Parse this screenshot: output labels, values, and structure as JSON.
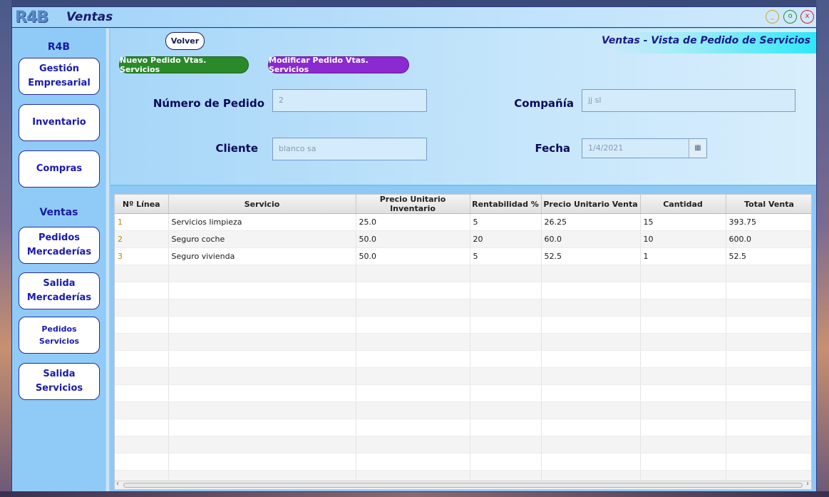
{
  "window": {
    "logo": "R4B",
    "title": "Ventas",
    "controls": {
      "minimize": "_",
      "maximize": "o",
      "close": "x"
    }
  },
  "sidebar": {
    "heading_top": "R4B",
    "heading_ventas": "Ventas",
    "items": [
      {
        "label": "Gestión\nEmpresarial"
      },
      {
        "label": "Inventario"
      },
      {
        "label": "Compras"
      },
      {
        "label": "Pedidos\nMercaderías"
      },
      {
        "label": "Salida\nMercaderías"
      },
      {
        "label": "Pedidos\nServicios"
      },
      {
        "label": "Salida\nServicios"
      }
    ]
  },
  "header": {
    "title": "Ventas - Vista de Pedido de Servicios",
    "volver_label": "Volver",
    "nuevo_label": "Nuevo Pedido Vtas. Servicios",
    "modificar_label": "Modificar Pedido Vtas. Servicios"
  },
  "form": {
    "numero_label": "Número de Pedido",
    "numero_value": "2",
    "compania_label": "Compañía",
    "compania_value": "jj sl",
    "cliente_label": "Cliente",
    "cliente_value": "blanco sa",
    "fecha_label": "Fecha",
    "fecha_value": "1/4/2021",
    "calendar_icon": "calendar-icon"
  },
  "table": {
    "columns": [
      "Nº Línea",
      "Servicio",
      "Precio Unitario Inventario",
      "Rentabilidad %",
      "Precio Unitario Venta",
      "Cantidad",
      "Total Venta"
    ],
    "rows": [
      [
        "1",
        "Servicios limpieza",
        "25.0",
        "5",
        "26.25",
        "15",
        "393.75"
      ],
      [
        "2",
        "Seguro coche",
        "50.0",
        "20",
        "60.0",
        "10",
        "600.0"
      ],
      [
        "3",
        "Seguro vivienda",
        "50.0",
        "5",
        "52.5",
        "1",
        "52.5"
      ]
    ],
    "empty_rows": 13
  },
  "colors": {
    "accent_green": "#2a8a2a",
    "accent_purple": "#8a2ad0",
    "sidebar_bg": "#8fcbf6",
    "text_navy": "#1a1aa0"
  }
}
